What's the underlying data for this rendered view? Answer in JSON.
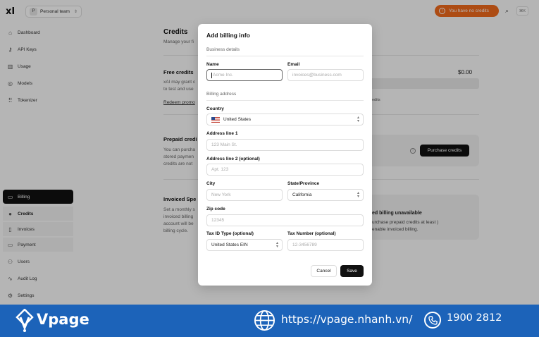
{
  "app": {
    "logo": "xI",
    "team": {
      "avatar": "P",
      "name": "Personal team"
    },
    "credits_pill": "You have no credits",
    "kbd": "⌘K"
  },
  "sidebar": {
    "items": [
      {
        "label": "Dashboard",
        "icon": "home-icon"
      },
      {
        "label": "API Keys",
        "icon": "key-icon"
      },
      {
        "label": "Usage",
        "icon": "bar-chart-icon"
      },
      {
        "label": "Models",
        "icon": "cube-icon"
      },
      {
        "label": "Tokenizer",
        "icon": "grid-icon"
      }
    ],
    "billing": {
      "label": "Billing",
      "icon": "card-icon"
    },
    "billing_sub": [
      {
        "label": "Credits",
        "icon": "dot-icon"
      },
      {
        "label": "Invoices",
        "icon": "file-icon"
      },
      {
        "label": "Payment",
        "icon": "card-icon"
      }
    ],
    "bottom": [
      {
        "label": "Users",
        "icon": "users-icon"
      },
      {
        "label": "Audit Log",
        "icon": "activity-icon"
      },
      {
        "label": "Settings",
        "icon": "gear-icon"
      }
    ]
  },
  "page": {
    "title": "Credits",
    "subtitle": "Manage your fi",
    "free_credits": {
      "title": "Free credits",
      "text1": "xAI may grant c",
      "text2": "to test and use",
      "link": "Redeem promo",
      "amount": "$0.00",
      "note": "edits"
    },
    "prepaid": {
      "title": "Prepaid credi",
      "text1": "You can purcha",
      "text2": "stored paymen",
      "text3": "credits are not",
      "button": "Purchase credits"
    },
    "invoiced": {
      "title": "Invoiced Spe",
      "text1": "Set a monthly s",
      "text2": "invoiced billing",
      "text3": "account will be",
      "text4": "billing cycle.",
      "card_title": "ed billing unavailable",
      "card_text": "urchase prepaid credits at least ) enable invoiced billing."
    }
  },
  "modal": {
    "title": "Add billing info",
    "business_section": "Business details",
    "name": {
      "label": "Name",
      "placeholder": "Acme Inc."
    },
    "email": {
      "label": "Email",
      "placeholder": "invoices@business.com"
    },
    "billing_section": "Billing address",
    "country": {
      "label": "Country",
      "value": "United States"
    },
    "address1": {
      "label": "Address line 1",
      "placeholder": "123 Main St."
    },
    "address2": {
      "label": "Address line 2 (optional)",
      "placeholder": "Apt. 123"
    },
    "city": {
      "label": "City",
      "placeholder": "New York"
    },
    "state": {
      "label": "State/Province",
      "value": "California"
    },
    "zip": {
      "label": "Zip code",
      "placeholder": "12345"
    },
    "tax_type": {
      "label": "Tax ID Type (optional)",
      "value": "United States EIN"
    },
    "tax_number": {
      "label": "Tax Number (optional)",
      "placeholder": "12-3456789"
    },
    "cancel": "Cancel",
    "save": "Save"
  },
  "banner": {
    "brand": "Vpage",
    "url": "https://vpage.nhanh.vn/",
    "phone": "1900 2812"
  },
  "colors": {
    "accent": "#f06a1c",
    "banner": "#1c63b9"
  }
}
